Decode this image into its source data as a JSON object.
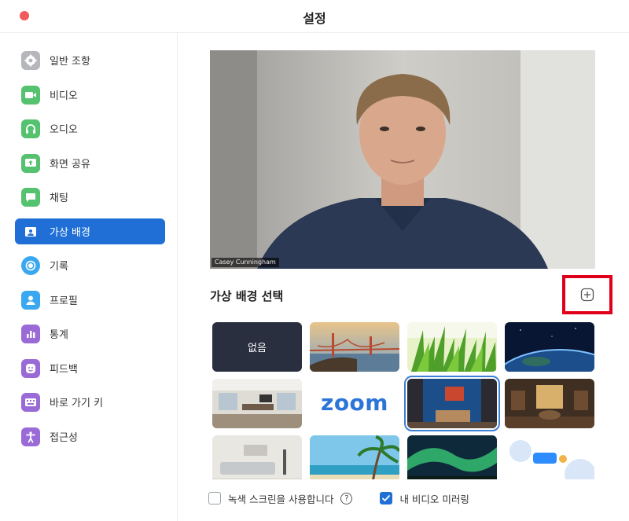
{
  "window": {
    "title": "설정"
  },
  "sidebar": {
    "items": [
      {
        "label": "일반 조항",
        "icon": "gear-icon",
        "color": "#b5b7bb"
      },
      {
        "label": "비디오",
        "icon": "video-camera-icon",
        "color": "#55c26f"
      },
      {
        "label": "오디오",
        "icon": "headphones-icon",
        "color": "#55c26f"
      },
      {
        "label": "화면 공유",
        "icon": "screen-share-icon",
        "color": "#55c26f"
      },
      {
        "label": "채팅",
        "icon": "chat-bubble-icon",
        "color": "#55c26f"
      },
      {
        "label": "가상 배경",
        "icon": "virtual-background-icon",
        "color": "#1f6fd6",
        "active": true
      },
      {
        "label": "기록",
        "icon": "record-icon",
        "color": "#3aa8f0"
      },
      {
        "label": "프로필",
        "icon": "profile-icon",
        "color": "#3aa8f0"
      },
      {
        "label": "통계",
        "icon": "statistics-icon",
        "color": "#9a6bd6"
      },
      {
        "label": "피드백",
        "icon": "feedback-smiley-icon",
        "color": "#9a6bd6"
      },
      {
        "label": "바로 가기 키",
        "icon": "keyboard-icon",
        "color": "#9a6bd6"
      },
      {
        "label": "접근성",
        "icon": "accessibility-icon",
        "color": "#9a6bd6"
      }
    ]
  },
  "preview": {
    "participant_name": "Casey Cunningham"
  },
  "backgrounds": {
    "section_title": "가상 배경 선택",
    "add_icon": "plus-icon",
    "none_label": "없음",
    "zoom_label": "zoom",
    "items": [
      {
        "name": "none"
      },
      {
        "name": "golden-gate-bridge"
      },
      {
        "name": "grass"
      },
      {
        "name": "earth-from-space"
      },
      {
        "name": "office-room"
      },
      {
        "name": "zoom-logo"
      },
      {
        "name": "blue-office-lobby",
        "selected": true
      },
      {
        "name": "vintage-room"
      },
      {
        "name": "living-room"
      },
      {
        "name": "beach-palm"
      },
      {
        "name": "aurora"
      },
      {
        "name": "zoom-illustration"
      }
    ]
  },
  "options": {
    "green_screen_label": "녹색 스크린을 사용합니다",
    "green_screen_checked": false,
    "help_icon": "question-mark-icon",
    "mirror_label": "내 비디오 미러링",
    "mirror_checked": true
  },
  "colors": {
    "accent": "#1f6fd6",
    "highlight": "#e0001a"
  }
}
